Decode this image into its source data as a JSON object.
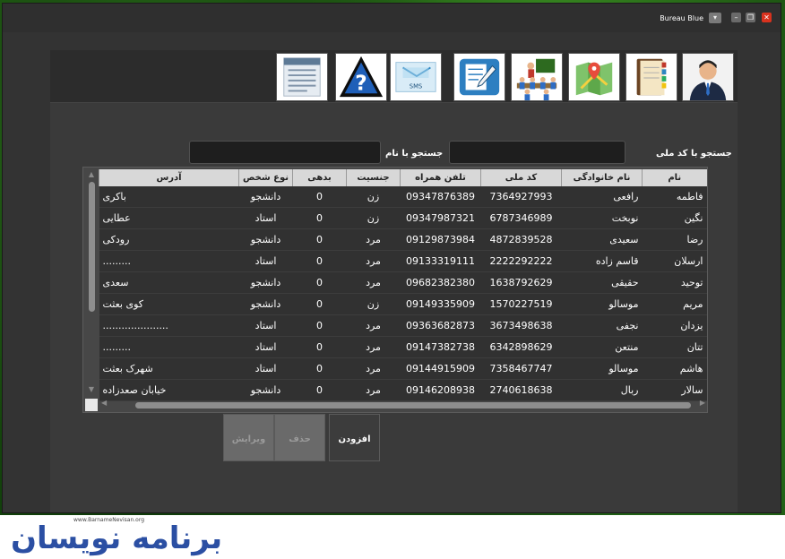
{
  "window": {
    "theme_label": "Bureau Blue",
    "theme_dropdown_icon": "chevron-down",
    "minimize_icon": "minimize",
    "maximize_icon": "restore",
    "close_icon": "close",
    "close_color": "#d8321e"
  },
  "toolbar": {
    "items": [
      {
        "name": "user-profile",
        "icon": "person-avatar"
      },
      {
        "name": "contacts-book",
        "icon": "address-book"
      },
      {
        "name": "map",
        "icon": "map-pin"
      },
      {
        "name": "meeting",
        "icon": "people-presentation"
      },
      {
        "name": "edit-note",
        "icon": "pencil-document"
      },
      {
        "name": "sms",
        "icon": "envelope-sms",
        "text": "SMS"
      },
      {
        "name": "help",
        "icon": "question-mark"
      },
      {
        "name": "report",
        "icon": "document-lines"
      }
    ]
  },
  "search": {
    "national_code_label": "جستجو با کد ملی",
    "national_code_value": "",
    "name_label": "جستجو با نام",
    "name_value": ""
  },
  "grid": {
    "columns": [
      "نام",
      "نام خانوادگی",
      "کد ملی",
      "تلفن همراه",
      "جنسیت",
      "بدهی",
      "نوع شخص",
      "آدرس"
    ],
    "rows": [
      [
        "فاطمه",
        "رافعی",
        "7364927993",
        "09347876389",
        "زن",
        "0",
        "دانشجو",
        "باکری"
      ],
      [
        "نگین",
        "نوبخت",
        "6787346989",
        "09347987321",
        "زن",
        "0",
        "استاد",
        "عطایی"
      ],
      [
        "رضا",
        "سعیدی",
        "4872839528",
        "09129873984",
        "مرد",
        "0",
        "دانشجو",
        "رودکی"
      ],
      [
        "ارسلان",
        "قاسم زاده",
        "2222292222",
        "09133319111",
        "مرد",
        "0",
        "استاد",
        "........."
      ],
      [
        "توحید",
        "حقیقی",
        "1638792629",
        "09682382380",
        "مرد",
        "0",
        "دانشجو",
        "سعدی"
      ],
      [
        "مریم",
        "موسالو",
        "1570227519",
        "09149335909",
        "زن",
        "0",
        "دانشجو",
        "کوی بعثت"
      ],
      [
        "یزدان",
        "نجفی",
        "3673498638",
        "09363682873",
        "مرد",
        "0",
        "استاد",
        "....................."
      ],
      [
        "تتان",
        "منتعن",
        "6342898629",
        "09147382738",
        "مرد",
        "0",
        "استاد",
        "........."
      ],
      [
        "هاشم",
        "موسالو",
        "7358467747",
        "09144915909",
        "مرد",
        "0",
        "استاد",
        "شهرک بعثت"
      ],
      [
        "سالار",
        "ربال",
        "2740618638",
        "09146208938",
        "مرد",
        "0",
        "دانشجو",
        "خیابان صعدزاده"
      ]
    ]
  },
  "actions": {
    "add_label": "افزودن",
    "delete_label": "حذف",
    "edit_label": "ویرایش"
  },
  "watermark": {
    "url": "www.BarnameNevisan.org",
    "logo_text": "برنامه نویسان"
  }
}
